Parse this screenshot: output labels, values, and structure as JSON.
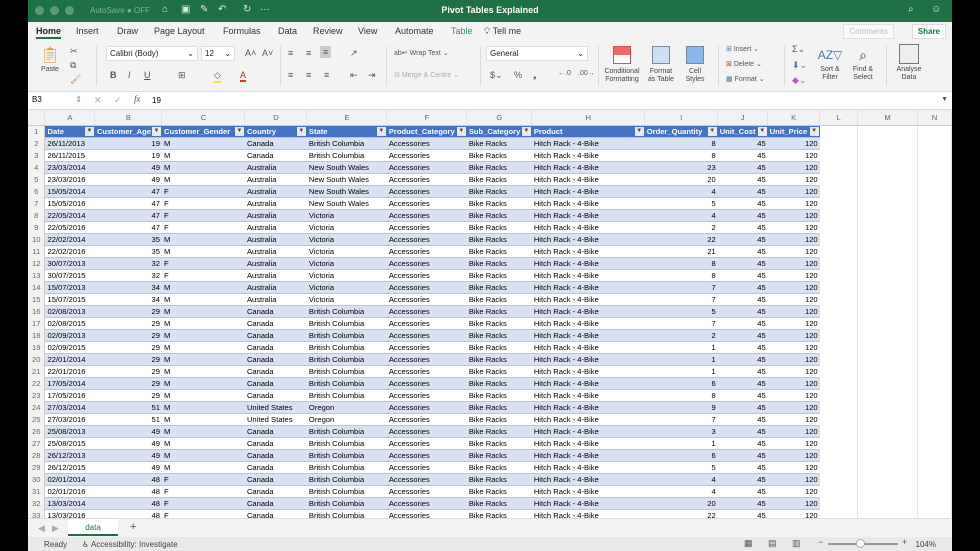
{
  "window": {
    "title": "Pivot Tables Explained",
    "autosave_label": "AutoSave",
    "autosave_state": "OFF"
  },
  "colors": {
    "titlebar": "#1f7145",
    "table_header": "#4472c4",
    "band": "#d9e1f2"
  },
  "menu_tabs": [
    "Home",
    "Insert",
    "Draw",
    "Page Layout",
    "Formulas",
    "Data",
    "Review",
    "View",
    "Automate",
    "Table"
  ],
  "tell_me": "Tell me",
  "comments_label": "Comments",
  "share_label": "Share",
  "ribbon": {
    "paste": "Paste",
    "font_name": "Calibri (Body)",
    "font_size": "12",
    "wrap_text": "Wrap Text",
    "merge": "Merge & Centre",
    "number_format": "General",
    "conditional": [
      "Conditional",
      "Formatting"
    ],
    "format_table": [
      "Format",
      "as Table"
    ],
    "cell_styles": [
      "Cell",
      "Styles"
    ],
    "insert": "Insert",
    "delete": "Delete",
    "format": "Format",
    "sort": [
      "Sort &",
      "Filter"
    ],
    "find": [
      "Find &",
      "Select"
    ],
    "analyse": [
      "Analyse",
      "Data"
    ],
    "bold": "B",
    "italic": "I",
    "underline": "U"
  },
  "formula_bar": {
    "name_box": "B3",
    "formula": "19"
  },
  "columns": [
    "A",
    "B",
    "C",
    "D",
    "E",
    "F",
    "G",
    "H",
    "I",
    "J",
    "K",
    "L",
    "M",
    "N"
  ],
  "headers": [
    "Date",
    "Customer_Age",
    "Customer_Gender",
    "Country",
    "State",
    "Product_Category",
    "Sub_Category",
    "Product",
    "Order_Quantity",
    "Unit_Cost",
    "Unit_Price"
  ],
  "rows": [
    [
      "26/11/2013",
      "19",
      "M",
      "Canada",
      "British Columbia",
      "Accessories",
      "Bike Racks",
      "Hitch Rack - 4-Bike",
      "8",
      "45",
      "120"
    ],
    [
      "26/11/2015",
      "19",
      "M",
      "Canada",
      "British Columbia",
      "Accessories",
      "Bike Racks",
      "Hitch Rack - 4-Bike",
      "8",
      "45",
      "120"
    ],
    [
      "23/03/2014",
      "49",
      "M",
      "Australia",
      "New South Wales",
      "Accessories",
      "Bike Racks",
      "Hitch Rack - 4-Bike",
      "23",
      "45",
      "120"
    ],
    [
      "23/03/2016",
      "49",
      "M",
      "Australia",
      "New South Wales",
      "Accessories",
      "Bike Racks",
      "Hitch Rack - 4-Bike",
      "20",
      "45",
      "120"
    ],
    [
      "15/05/2014",
      "47",
      "F",
      "Australia",
      "New South Wales",
      "Accessories",
      "Bike Racks",
      "Hitch Rack - 4-Bike",
      "4",
      "45",
      "120"
    ],
    [
      "15/05/2016",
      "47",
      "F",
      "Australia",
      "New South Wales",
      "Accessories",
      "Bike Racks",
      "Hitch Rack - 4-Bike",
      "5",
      "45",
      "120"
    ],
    [
      "22/05/2014",
      "47",
      "F",
      "Australia",
      "Victoria",
      "Accessories",
      "Bike Racks",
      "Hitch Rack - 4-Bike",
      "4",
      "45",
      "120"
    ],
    [
      "22/05/2016",
      "47",
      "F",
      "Australia",
      "Victoria",
      "Accessories",
      "Bike Racks",
      "Hitch Rack - 4-Bike",
      "2",
      "45",
      "120"
    ],
    [
      "22/02/2014",
      "35",
      "M",
      "Australia",
      "Victoria",
      "Accessories",
      "Bike Racks",
      "Hitch Rack - 4-Bike",
      "22",
      "45",
      "120"
    ],
    [
      "22/02/2016",
      "35",
      "M",
      "Australia",
      "Victoria",
      "Accessories",
      "Bike Racks",
      "Hitch Rack - 4-Bike",
      "21",
      "45",
      "120"
    ],
    [
      "30/07/2013",
      "32",
      "F",
      "Australia",
      "Victoria",
      "Accessories",
      "Bike Racks",
      "Hitch Rack - 4-Bike",
      "8",
      "45",
      "120"
    ],
    [
      "30/07/2015",
      "32",
      "F",
      "Australia",
      "Victoria",
      "Accessories",
      "Bike Racks",
      "Hitch Rack - 4-Bike",
      "8",
      "45",
      "120"
    ],
    [
      "15/07/2013",
      "34",
      "M",
      "Australia",
      "Victoria",
      "Accessories",
      "Bike Racks",
      "Hitch Rack - 4-Bike",
      "7",
      "45",
      "120"
    ],
    [
      "15/07/2015",
      "34",
      "M",
      "Australia",
      "Victoria",
      "Accessories",
      "Bike Racks",
      "Hitch Rack - 4-Bike",
      "7",
      "45",
      "120"
    ],
    [
      "02/08/2013",
      "29",
      "M",
      "Canada",
      "British Columbia",
      "Accessories",
      "Bike Racks",
      "Hitch Rack - 4-Bike",
      "5",
      "45",
      "120"
    ],
    [
      "02/08/2015",
      "29",
      "M",
      "Canada",
      "British Columbia",
      "Accessories",
      "Bike Racks",
      "Hitch Rack - 4-Bike",
      "7",
      "45",
      "120"
    ],
    [
      "02/09/2013",
      "29",
      "M",
      "Canada",
      "British Columbia",
      "Accessories",
      "Bike Racks",
      "Hitch Rack - 4-Bike",
      "2",
      "45",
      "120"
    ],
    [
      "02/09/2015",
      "29",
      "M",
      "Canada",
      "British Columbia",
      "Accessories",
      "Bike Racks",
      "Hitch Rack - 4-Bike",
      "1",
      "45",
      "120"
    ],
    [
      "22/01/2014",
      "29",
      "M",
      "Canada",
      "British Columbia",
      "Accessories",
      "Bike Racks",
      "Hitch Rack - 4-Bike",
      "1",
      "45",
      "120"
    ],
    [
      "22/01/2016",
      "29",
      "M",
      "Canada",
      "British Columbia",
      "Accessories",
      "Bike Racks",
      "Hitch Rack - 4-Bike",
      "1",
      "45",
      "120"
    ],
    [
      "17/05/2014",
      "29",
      "M",
      "Canada",
      "British Columbia",
      "Accessories",
      "Bike Racks",
      "Hitch Rack - 4-Bike",
      "6",
      "45",
      "120"
    ],
    [
      "17/05/2016",
      "29",
      "M",
      "Canada",
      "British Columbia",
      "Accessories",
      "Bike Racks",
      "Hitch Rack - 4-Bike",
      "8",
      "45",
      "120"
    ],
    [
      "27/03/2014",
      "51",
      "M",
      "United States",
      "Oregon",
      "Accessories",
      "Bike Racks",
      "Hitch Rack - 4-Bike",
      "9",
      "45",
      "120"
    ],
    [
      "27/03/2016",
      "51",
      "M",
      "United States",
      "Oregon",
      "Accessories",
      "Bike Racks",
      "Hitch Rack - 4-Bike",
      "7",
      "45",
      "120"
    ],
    [
      "25/08/2013",
      "49",
      "M",
      "Canada",
      "British Columbia",
      "Accessories",
      "Bike Racks",
      "Hitch Rack - 4-Bike",
      "3",
      "45",
      "120"
    ],
    [
      "25/08/2015",
      "49",
      "M",
      "Canada",
      "British Columbia",
      "Accessories",
      "Bike Racks",
      "Hitch Rack - 4-Bike",
      "1",
      "45",
      "120"
    ],
    [
      "26/12/2013",
      "49",
      "M",
      "Canada",
      "British Columbia",
      "Accessories",
      "Bike Racks",
      "Hitch Rack - 4-Bike",
      "6",
      "45",
      "120"
    ],
    [
      "26/12/2015",
      "49",
      "M",
      "Canada",
      "British Columbia",
      "Accessories",
      "Bike Racks",
      "Hitch Rack - 4-Bike",
      "5",
      "45",
      "120"
    ],
    [
      "02/01/2014",
      "48",
      "F",
      "Canada",
      "British Columbia",
      "Accessories",
      "Bike Racks",
      "Hitch Rack - 4-Bike",
      "4",
      "45",
      "120"
    ],
    [
      "02/01/2016",
      "48",
      "F",
      "Canada",
      "British Columbia",
      "Accessories",
      "Bike Racks",
      "Hitch Rack - 4-Bike",
      "4",
      "45",
      "120"
    ],
    [
      "13/03/2014",
      "48",
      "F",
      "Canada",
      "British Columbia",
      "Accessories",
      "Bike Racks",
      "Hitch Rack - 4-Bike",
      "20",
      "45",
      "120"
    ],
    [
      "13/03/2016",
      "48",
      "F",
      "Canada",
      "British Columbia",
      "Accessories",
      "Bike Racks",
      "Hitch Rack - 4-Bike",
      "22",
      "45",
      "120"
    ],
    [
      "23/05/2014",
      "47",
      "F",
      "Canada",
      "British Columbia",
      "Accessories",
      "Bike Racks",
      "Hitch Rack - 4-Bike",
      "24",
      "45",
      "120"
    ],
    [
      "23/05/2016",
      "47",
      "F",
      "Canada",
      "British Columbia",
      "Accessories",
      "Bike Racks",
      "Hitch Rack - 4-Bike",
      "23",
      "45",
      "120"
    ]
  ],
  "sheet_tabs": [
    "data"
  ],
  "status": {
    "ready": "Ready",
    "accessibility": "Accessibility: Investigate",
    "zoom": "104%"
  }
}
